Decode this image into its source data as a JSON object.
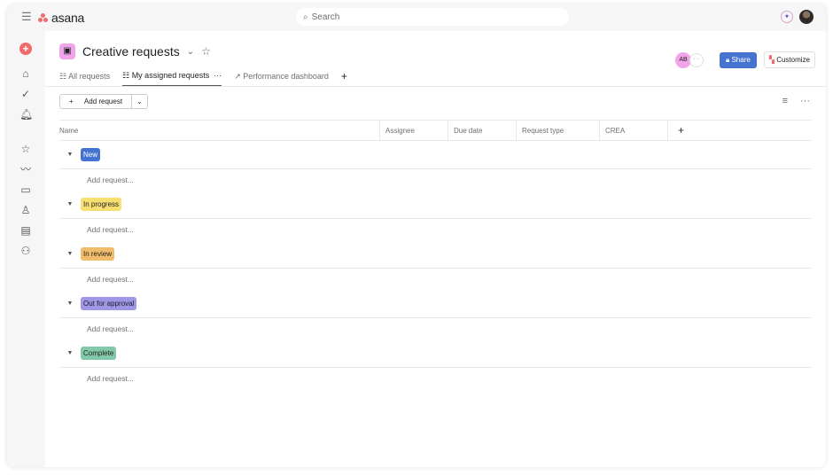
{
  "app": {
    "logo": "asana",
    "search_placeholder": "Search"
  },
  "project": {
    "title": "Creative requests",
    "tabs": [
      {
        "label": "All requests"
      },
      {
        "label": "My assigned requests"
      },
      {
        "label": "Performance dashboard"
      }
    ],
    "member_initials": "AB",
    "share": "Share",
    "customize": "Customize"
  },
  "toolbar": {
    "add_request": "Add request"
  },
  "table": {
    "columns": [
      "Name",
      "Assignee",
      "Due date",
      "Request type",
      "CREA"
    ],
    "sections": [
      {
        "name": "New",
        "color": "#4573d2",
        "text_color": "#ffffff",
        "add": "Add request..."
      },
      {
        "name": "In progress",
        "color": "#f8df72",
        "text_color": "#1e1f21",
        "add": "Add request..."
      },
      {
        "name": "In review",
        "color": "#f1bd6c",
        "text_color": "#1e1f21",
        "add": "Add request..."
      },
      {
        "name": "Out for approval",
        "color": "#9e97e8",
        "text_color": "#1e1f21",
        "add": "Add request..."
      },
      {
        "name": "Complete",
        "color": "#83c9a9",
        "text_color": "#1e1f21",
        "add": "Add request..."
      }
    ]
  }
}
